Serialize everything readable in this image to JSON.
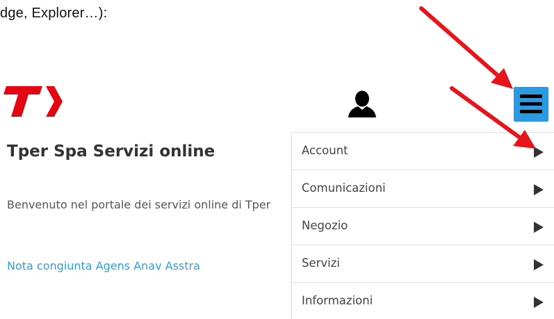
{
  "caption": {
    "text": "dge, Explorer…):"
  },
  "header": {
    "logo_icon": "tper-logo",
    "brand_color": "#e30613",
    "user_icon": "user-icon",
    "menu_icon": "hamburger-menu-icon",
    "menu_button_color": "#2a9be3"
  },
  "main": {
    "title": "Tper Spa Servizi online",
    "welcome_text": "Benvenuto nel portale dei servizi online di Tper",
    "note_link": "Nota congiunta Agens Anav Asstra",
    "link_color": "#2aa3d8"
  },
  "menu": {
    "items": [
      {
        "label": "Account"
      },
      {
        "label": "Comunicazioni"
      },
      {
        "label": "Negozio"
      },
      {
        "label": "Servizi"
      },
      {
        "label": "Informazioni"
      }
    ],
    "caret_icon": "caret-right-icon"
  },
  "annotations": {
    "arrow_color": "#e8141b",
    "arrow_icon": "red-arrow-annotation"
  }
}
